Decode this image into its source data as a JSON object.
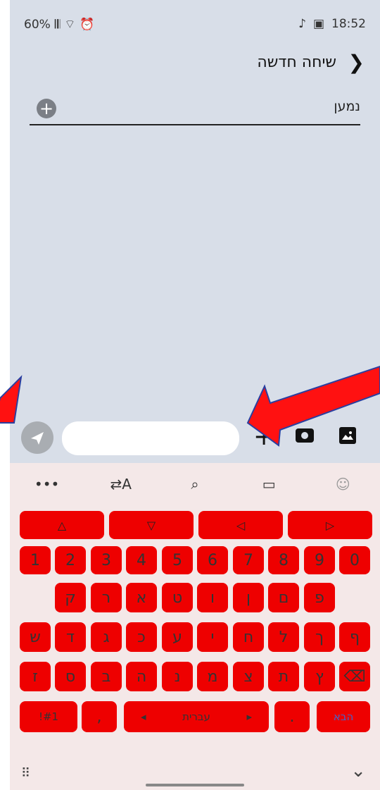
{
  "status_bar": {
    "battery": "60%",
    "signal": "𝄃𝄃",
    "wifi": "⌔",
    "alarm": "⏰",
    "music": "♪",
    "gallery": "▣",
    "time": "18:52"
  },
  "header": {
    "title": "שיחה חדשה",
    "back_icon": "chevron-right"
  },
  "recipient": {
    "label": "נמען"
  },
  "compose": {
    "message_placeholder": "",
    "plus": "+"
  },
  "keyboard": {
    "toolbar": [
      "•••",
      "⇄A",
      "⌕",
      "▭",
      "☺"
    ],
    "arrows": [
      "△",
      "▽",
      "◁",
      "▷"
    ],
    "numbers": [
      "1",
      "2",
      "3",
      "4",
      "5",
      "6",
      "7",
      "8",
      "9",
      "0"
    ],
    "row1": [
      "ק",
      "ר",
      "א",
      "ט",
      "ו",
      "ן",
      "ם",
      "פ"
    ],
    "row2": [
      "ש",
      "ד",
      "ג",
      "כ",
      "ע",
      "י",
      "ח",
      "ל",
      "ך",
      "ף"
    ],
    "row3": [
      "ז",
      "ס",
      "ב",
      "ה",
      "נ",
      "מ",
      "צ",
      "ת",
      "ץ"
    ],
    "backspace": "⌫",
    "symbols": "!#1",
    "comma": ",",
    "space_label": "עברית",
    "space_left": "◂",
    "space_right": "▸",
    "period": ".",
    "enter": "הבא",
    "grid_icon": "⠿",
    "collapse_icon": "⌄"
  },
  "colors": {
    "key_red": "#ee0000",
    "annotation_red": "#ff1111",
    "enter_text": "#4466cc"
  }
}
